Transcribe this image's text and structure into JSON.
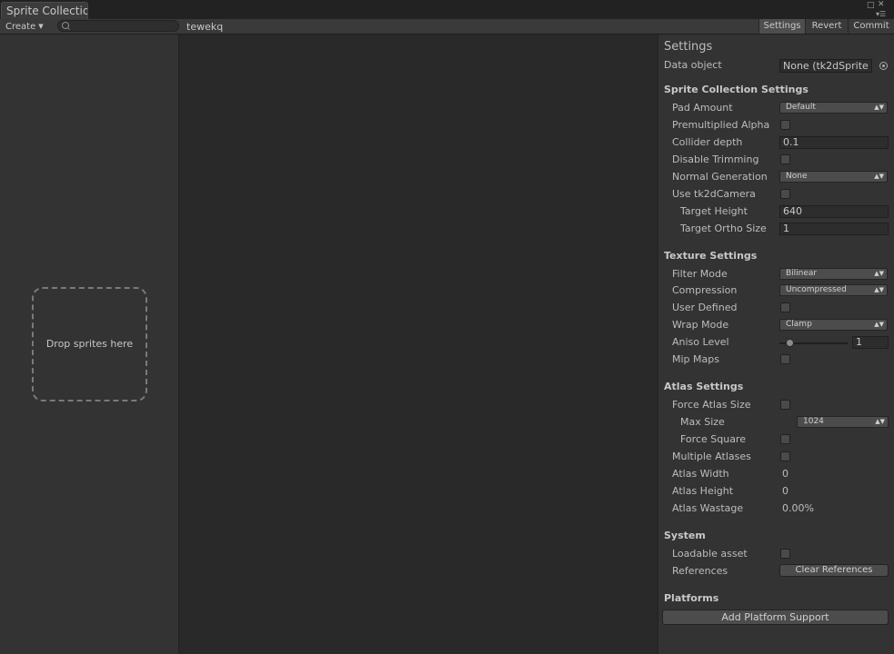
{
  "window": {
    "tab_title": "Sprite Collectic"
  },
  "toolbar": {
    "create_label": "Create",
    "search": {
      "value": "",
      "placeholder": ""
    },
    "collection_name": "tewekq",
    "settings_label": "Settings",
    "revert_label": "Revert",
    "commit_label": "Commit"
  },
  "left_panel": {
    "drop_label": "Drop sprites here"
  },
  "inspector": {
    "title": "Settings",
    "data_object_label": "Data object",
    "data_object_value": "None (tk2dSprite",
    "sprite_collection": {
      "header": "Sprite Collection Settings",
      "pad_amount_label": "Pad Amount",
      "pad_amount_value": "Default",
      "premultiplied_alpha_label": "Premultiplied Alpha",
      "premultiplied_alpha": false,
      "collider_depth_label": "Collider depth",
      "collider_depth_value": "0.1",
      "disable_trimming_label": "Disable Trimming",
      "disable_trimming": false,
      "normal_generation_label": "Normal Generation",
      "normal_generation_value": "None",
      "use_tk2dcamera_label": "Use tk2dCamera",
      "use_tk2dcamera": false,
      "target_height_label": "Target Height",
      "target_height_value": "640",
      "target_ortho_label": "Target Ortho Size",
      "target_ortho_value": "1"
    },
    "texture": {
      "header": "Texture Settings",
      "filter_mode_label": "Filter Mode",
      "filter_mode_value": "Bilinear",
      "compression_label": "Compression",
      "compression_value": "Uncompressed",
      "user_defined_label": "User Defined",
      "user_defined": false,
      "wrap_mode_label": "Wrap Mode",
      "wrap_mode_value": "Clamp",
      "aniso_label": "Aniso Level",
      "aniso_value": "1",
      "mip_maps_label": "Mip Maps",
      "mip_maps": false
    },
    "atlas": {
      "header": "Atlas Settings",
      "force_size_label": "Force Atlas Size",
      "force_size": false,
      "max_size_label": "Max Size",
      "max_size_value": "1024",
      "force_square_label": "Force Square",
      "force_square": false,
      "multiple_label": "Multiple Atlases",
      "multiple": false,
      "width_label": "Atlas Width",
      "width_value": "0",
      "height_label": "Atlas Height",
      "height_value": "0",
      "wastage_label": "Atlas Wastage",
      "wastage_value": "0.00%"
    },
    "system": {
      "header": "System",
      "loadable_label": "Loadable asset",
      "loadable": false,
      "references_label": "References",
      "clear_references_label": "Clear References"
    },
    "platforms": {
      "header": "Platforms",
      "add_support_label": "Add Platform Support"
    }
  },
  "colors": {
    "background": "#292929",
    "panel": "#333333",
    "toolbar": "#3a3a3a",
    "text": "#bdbdbd"
  }
}
